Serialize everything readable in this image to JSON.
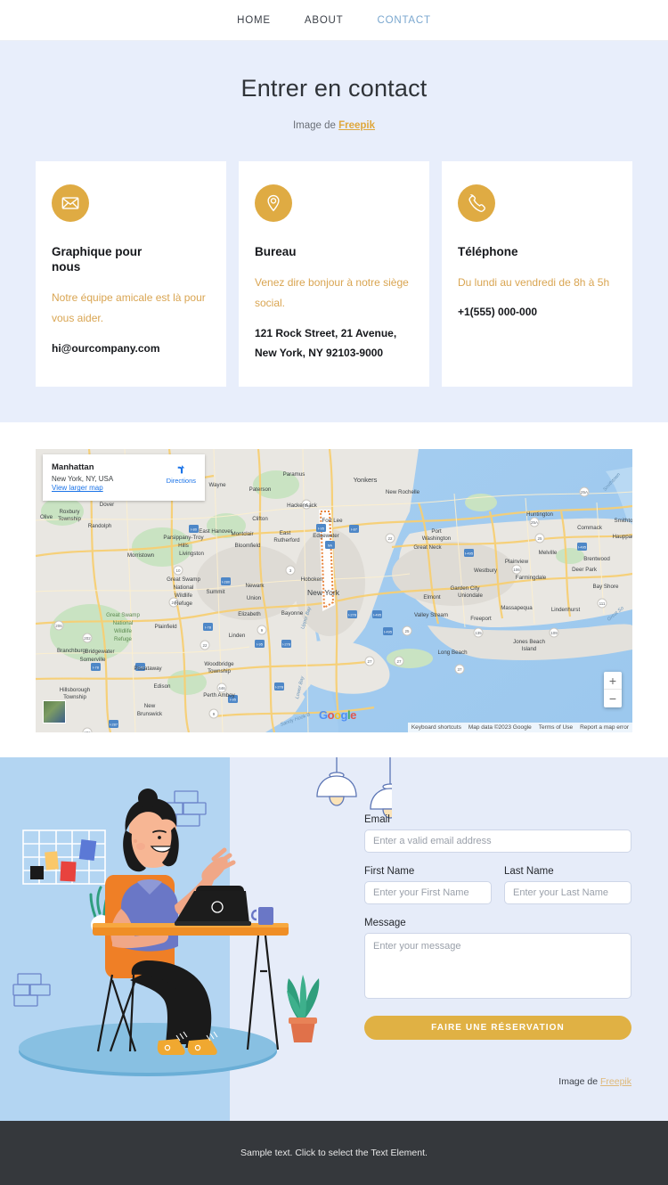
{
  "nav": {
    "items": [
      {
        "label": "HOME",
        "active": false
      },
      {
        "label": "ABOUT",
        "active": false
      },
      {
        "label": "CONTACT",
        "active": true
      }
    ]
  },
  "hero": {
    "title": "Entrer en contact",
    "credit_prefix": "Image de ",
    "credit_link": "Freepik"
  },
  "cards": [
    {
      "icon": "envelope-icon",
      "title": "Graphique pour nous",
      "subtitle": "Notre équipe amicale est là pour vous aider.",
      "info": "hi@ourcompany.com"
    },
    {
      "icon": "location-pin-icon",
      "title": "Bureau",
      "subtitle": "Venez dire bonjour à notre siège social.",
      "info": "121 Rock Street, 21 Avenue,\nNew York, NY 92103-9000"
    },
    {
      "icon": "phone-icon",
      "title": "Téléphone",
      "subtitle": "Du lundi au vendredi de 8h à 5h",
      "info": "+1(555) 000-000"
    }
  ],
  "map": {
    "place_title": "Manhattan",
    "place_address": "New York, NY, USA",
    "view_larger": "View larger map",
    "directions": "Directions",
    "zoom_in": "+",
    "zoom_out": "−",
    "attribution": [
      "Keyboard shortcuts",
      "Map data ©2023 Google",
      "Terms of Use",
      "Report a map error"
    ],
    "labels": [
      "Paramus",
      "Yonkers",
      "New Rochelle",
      "Wayne",
      "Paterson",
      "Hackensack",
      "Clifton",
      "Fort Lee",
      "Edgewater",
      "Huntington",
      "Dover",
      "Parsippany-Troy Hills",
      "Montclair",
      "East Rutherford",
      "Port Washington",
      "Commack",
      "Smithto",
      "Roxbury Township",
      "Randolph",
      "East Hanover",
      "Bloomfield",
      "Great Neck",
      "Melville",
      "Hauppau",
      "Morristown",
      "Livingston",
      "Plainview",
      "Brentwood",
      "Newark",
      "Hoboken",
      "Westbury",
      "Farmingdale",
      "Deer Park",
      "Great Swamp National Wildlife Refuge",
      "Summit",
      "Union",
      "Garden City",
      "Bay Shore",
      "New York",
      "Elmont",
      "Uniondale",
      "Massapequa",
      "Lindenhurst",
      "Elizabeth",
      "Bayonne",
      "Valley Stream",
      "Freeport",
      "Plainfield",
      "Linden",
      "Great So",
      "Branchburg",
      "Bridgewater",
      "Somerville",
      "Piscataway",
      "Woodbridge Township",
      "Long Beach",
      "Jones Beach Island",
      "Hillsborough Township",
      "Edison",
      "Perth Amboy",
      "New Brunswick",
      "Sandy Hook B",
      "Upper Bay",
      "Lower Bay",
      "Smithtown",
      "Olive"
    ]
  },
  "form": {
    "email_label": "Email",
    "email_placeholder": "Enter a valid email address",
    "first_name_label": "First Name",
    "first_name_placeholder": "Enter your First Name",
    "last_name_label": "Last Name",
    "last_name_placeholder": "Enter your Last Name",
    "message_label": "Message",
    "message_placeholder": "Enter your message",
    "submit_label": "FAIRE UNE RÉSERVATION",
    "credit_prefix": "Image de ",
    "credit_link": "Freepik"
  },
  "footer": {
    "text": "Sample text. Click to select the Text Element."
  },
  "colors": {
    "accent": "#dfab43",
    "hero_bg": "#e8eefb",
    "illustration_blue": "#b3d5f2",
    "form_bg": "#e6ecf9",
    "footer_bg": "#35383c",
    "link_blue": "#1a73e8",
    "nav_active": "#7aa7cf"
  }
}
